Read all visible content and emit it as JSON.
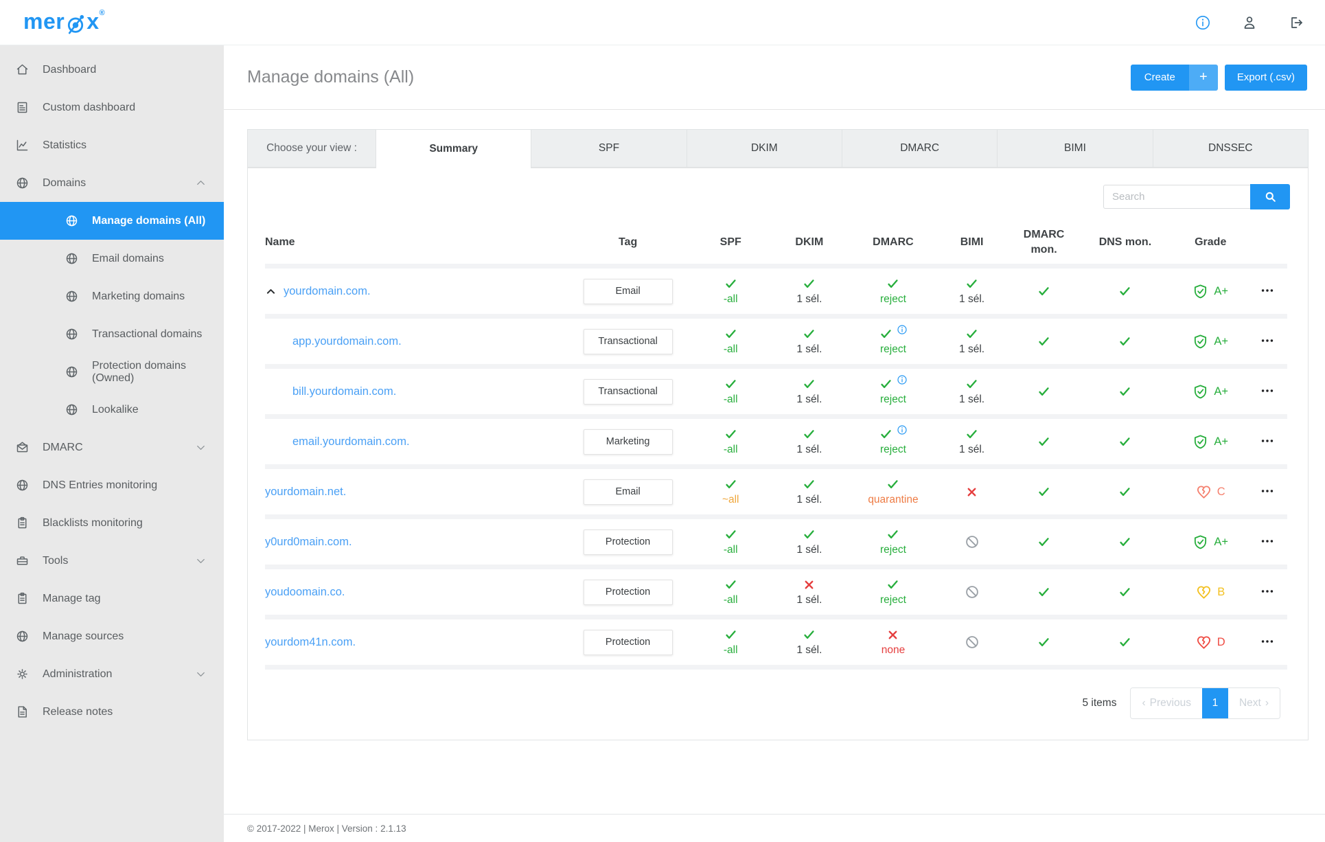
{
  "brand": {
    "name_left": "mer",
    "name_right": "x",
    "registered": "®"
  },
  "topbar": {
    "icons": [
      {
        "name": "info-icon"
      },
      {
        "name": "user-icon"
      },
      {
        "name": "logout-icon"
      }
    ]
  },
  "sidebar": {
    "items": [
      {
        "label": "Dashboard",
        "icon": "home"
      },
      {
        "label": "Custom dashboard",
        "icon": "doc"
      },
      {
        "label": "Statistics",
        "icon": "chart"
      },
      {
        "label": "Domains",
        "icon": "globe",
        "chevron": "up"
      },
      {
        "label": "Manage domains (All)",
        "icon": "globe",
        "sub": true,
        "active": true
      },
      {
        "label": "Email domains",
        "icon": "globe",
        "sub": true
      },
      {
        "label": "Marketing domains",
        "icon": "globe",
        "sub": true
      },
      {
        "label": "Transactional domains",
        "icon": "globe",
        "sub": true
      },
      {
        "label": "Protection domains (Owned)",
        "icon": "globe",
        "sub": true
      },
      {
        "label": "Lookalike",
        "icon": "globe",
        "sub": true
      },
      {
        "label": "DMARC",
        "icon": "mail",
        "chevron": "down"
      },
      {
        "label": "DNS Entries monitoring",
        "icon": "globe"
      },
      {
        "label": "Blacklists monitoring",
        "icon": "clipboard"
      },
      {
        "label": "Tools",
        "icon": "toolbox",
        "chevron": "down"
      },
      {
        "label": "Manage tag",
        "icon": "clipboard"
      },
      {
        "label": "Manage sources",
        "icon": "globe"
      },
      {
        "label": "Administration",
        "icon": "gear",
        "chevron": "down"
      },
      {
        "label": "Release notes",
        "icon": "notes"
      }
    ]
  },
  "page": {
    "title": "Manage domains (All)",
    "create_button": {
      "label": "Create",
      "plus": "+"
    },
    "export_button": "Export (.csv)"
  },
  "view_tabs": {
    "label": "Choose your view :",
    "tabs": [
      {
        "label": "Summary",
        "active": true
      },
      {
        "label": "SPF"
      },
      {
        "label": "DKIM"
      },
      {
        "label": "DMARC"
      },
      {
        "label": "BIMI"
      },
      {
        "label": "DNSSEC"
      }
    ]
  },
  "search": {
    "placeholder": "Search"
  },
  "table": {
    "columns": [
      "Name",
      "Tag",
      "SPF",
      "DKIM",
      "DMARC",
      "BIMI",
      "DMARC mon.",
      "DNS mon.",
      "Grade"
    ],
    "rows": [
      {
        "name": "yourdomain.com.",
        "caret": true,
        "indent": false,
        "tag": "Email",
        "spf": {
          "icon": "check",
          "label": "-all",
          "color": "green"
        },
        "dkim": {
          "icon": "check",
          "label": "1 sél.",
          "color": "dark"
        },
        "dmarc": {
          "icon": "check",
          "label": "reject",
          "color": "green"
        },
        "bimi": {
          "icon": "check",
          "label": "1 sél.",
          "color": "dark"
        },
        "dmarc_mon": {
          "icon": "check"
        },
        "dns_mon": {
          "icon": "check"
        },
        "grade": {
          "letter": "A+",
          "icon": "shield",
          "color": "green"
        }
      },
      {
        "name": "app.yourdomain.com.",
        "caret": false,
        "indent": true,
        "tag": "Transactional",
        "spf": {
          "icon": "check",
          "label": "-all",
          "color": "green"
        },
        "dkim": {
          "icon": "check",
          "label": "1 sél.",
          "color": "dark"
        },
        "dmarc": {
          "icon": "check",
          "info": true,
          "label": "reject",
          "color": "green"
        },
        "bimi": {
          "icon": "check",
          "label": "1 sél.",
          "color": "dark"
        },
        "dmarc_mon": {
          "icon": "check"
        },
        "dns_mon": {
          "icon": "check"
        },
        "grade": {
          "letter": "A+",
          "icon": "shield",
          "color": "green"
        }
      },
      {
        "name": "bill.yourdomain.com.",
        "caret": false,
        "indent": true,
        "tag": "Transactional",
        "spf": {
          "icon": "check",
          "label": "-all",
          "color": "green"
        },
        "dkim": {
          "icon": "check",
          "label": "1 sél.",
          "color": "dark"
        },
        "dmarc": {
          "icon": "check",
          "info": true,
          "label": "reject",
          "color": "green"
        },
        "bimi": {
          "icon": "check",
          "label": "1 sél.",
          "color": "dark"
        },
        "dmarc_mon": {
          "icon": "check"
        },
        "dns_mon": {
          "icon": "check"
        },
        "grade": {
          "letter": "A+",
          "icon": "shield",
          "color": "green"
        }
      },
      {
        "name": "email.yourdomain.com.",
        "caret": false,
        "indent": true,
        "tag": "Marketing",
        "spf": {
          "icon": "check",
          "label": "-all",
          "color": "green"
        },
        "dkim": {
          "icon": "check",
          "label": "1 sél.",
          "color": "dark"
        },
        "dmarc": {
          "icon": "check",
          "info": true,
          "label": "reject",
          "color": "green"
        },
        "bimi": {
          "icon": "check",
          "label": "1 sél.",
          "color": "dark"
        },
        "dmarc_mon": {
          "icon": "check"
        },
        "dns_mon": {
          "icon": "check"
        },
        "grade": {
          "letter": "A+",
          "icon": "shield",
          "color": "green"
        }
      },
      {
        "name": "yourdomain.net.",
        "caret": false,
        "indent": false,
        "tag": "Email",
        "spf": {
          "icon": "check",
          "label": "~all",
          "color": "yellow"
        },
        "dkim": {
          "icon": "check",
          "label": "1 sél.",
          "color": "dark"
        },
        "dmarc": {
          "icon": "check",
          "label": "quarantine",
          "color": "orange"
        },
        "bimi": {
          "icon": "x"
        },
        "dmarc_mon": {
          "icon": "check"
        },
        "dns_mon": {
          "icon": "check"
        },
        "grade": {
          "letter": "C",
          "icon": "heart",
          "color": "salmon"
        }
      },
      {
        "name": "y0urd0main.com.",
        "caret": false,
        "indent": false,
        "tag": "Protection",
        "spf": {
          "icon": "check",
          "label": "-all",
          "color": "green"
        },
        "dkim": {
          "icon": "check",
          "label": "1 sél.",
          "color": "dark"
        },
        "dmarc": {
          "icon": "check",
          "label": "reject",
          "color": "green"
        },
        "bimi": {
          "icon": "ban"
        },
        "dmarc_mon": {
          "icon": "check"
        },
        "dns_mon": {
          "icon": "check"
        },
        "grade": {
          "letter": "A+",
          "icon": "shield",
          "color": "green"
        }
      },
      {
        "name": "youdoomain.co.",
        "caret": false,
        "indent": false,
        "tag": "Protection",
        "spf": {
          "icon": "check",
          "label": "-all",
          "color": "green"
        },
        "dkim": {
          "icon": "x",
          "label": "1 sél.",
          "color": "dark"
        },
        "dmarc": {
          "icon": "check",
          "label": "reject",
          "color": "green"
        },
        "bimi": {
          "icon": "ban"
        },
        "dmarc_mon": {
          "icon": "check"
        },
        "dns_mon": {
          "icon": "check"
        },
        "grade": {
          "letter": "B",
          "icon": "heart",
          "color": "gold"
        }
      },
      {
        "name": "yourdom41n.com.",
        "caret": false,
        "indent": false,
        "tag": "Protection",
        "spf": {
          "icon": "check",
          "label": "-all",
          "color": "green"
        },
        "dkim": {
          "icon": "check",
          "label": "1 sél.",
          "color": "dark"
        },
        "dmarc": {
          "icon": "x",
          "label": "none",
          "color": "red"
        },
        "bimi": {
          "icon": "ban"
        },
        "dmarc_mon": {
          "icon": "check"
        },
        "dns_mon": {
          "icon": "check"
        },
        "grade": {
          "letter": "D",
          "icon": "heart",
          "color": "red"
        }
      }
    ]
  },
  "pagination": {
    "count_label": "5 items",
    "previous_label": "Previous",
    "current_page": "1",
    "next_label": "Next"
  },
  "footer": {
    "text": "© 2017-2022 | Merox | Version : 2.1.13"
  },
  "colors": {
    "accent_blue": "#2196f3",
    "link_blue": "#4aa0f5",
    "success_green": "#27ae3c",
    "warning_yellow": "#f0a73c",
    "warning_orange": "#ee7c45",
    "error_red": "#e53e3e",
    "ban_gray": "#9aa0a6",
    "grade_b_yellow": "#f3c01f",
    "grade_c_salmon": "#f5806e",
    "grade_d_red": "#ef4b42",
    "sidebar_bg": "#e9e9e9"
  }
}
